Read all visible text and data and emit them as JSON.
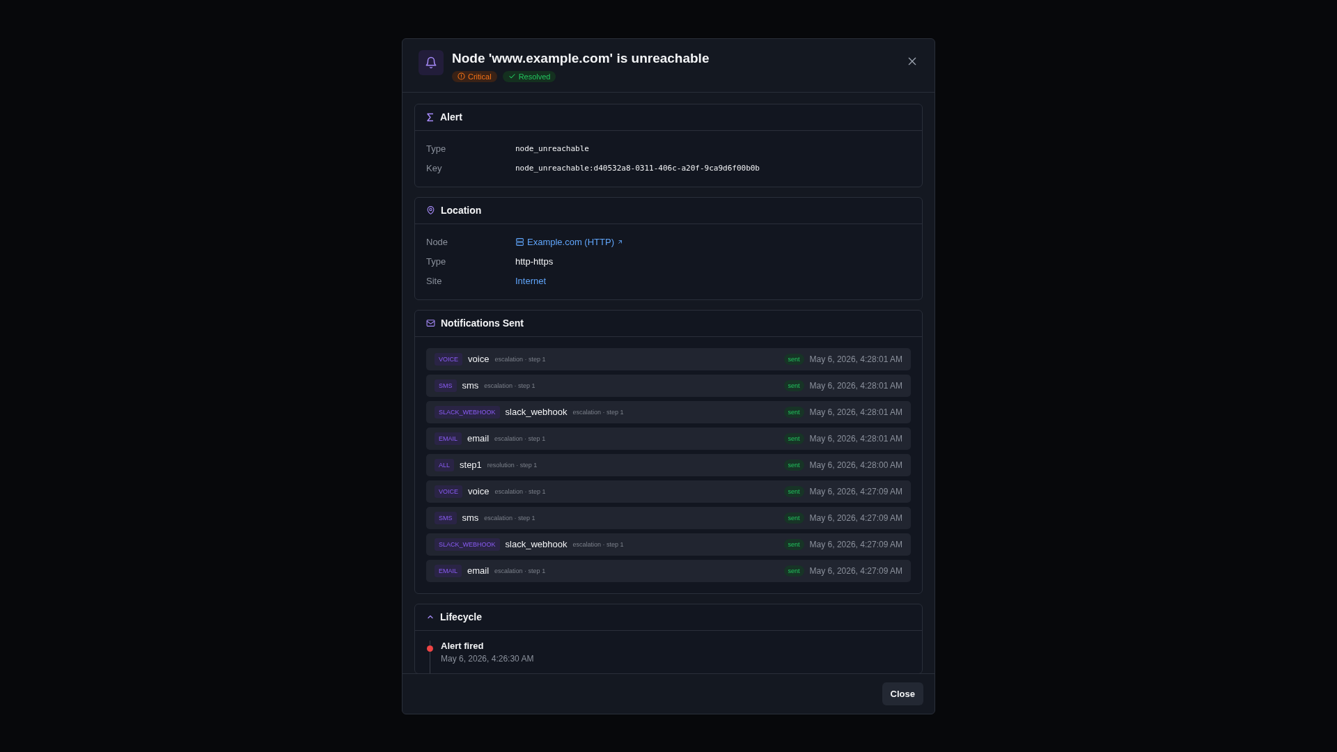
{
  "dialog": {
    "title": "Node 'www.example.com' is unreachable",
    "badges": [
      {
        "kind": "severity",
        "label": "Critical"
      },
      {
        "kind": "state",
        "label": "Resolved"
      }
    ],
    "close_button": "Close"
  },
  "alert": {
    "title": "Alert",
    "rows": [
      {
        "label": "Type",
        "value": "node_unreachable",
        "kind": "mono"
      },
      {
        "label": "Key",
        "value": "node_unreachable:d40532a8-0311-406c-a20f-9ca9d6f00b0b",
        "kind": "mono"
      }
    ]
  },
  "location": {
    "title": "Location",
    "rows": [
      {
        "label": "Node",
        "value": "Example.com (HTTP)",
        "kind": "node-link"
      },
      {
        "label": "Type",
        "value": "http-https",
        "kind": "text"
      },
      {
        "label": "Site",
        "value": "Internet",
        "kind": "link"
      }
    ]
  },
  "notifications": {
    "title": "Notifications Sent",
    "items": [
      {
        "channel": "VOICE",
        "target": "voice",
        "meta": "escalation · step 1",
        "status": "sent",
        "time": "May 6, 2026, 4:28:01 AM"
      },
      {
        "channel": "SMS",
        "target": "sms",
        "meta": "escalation · step 1",
        "status": "sent",
        "time": "May 6, 2026, 4:28:01 AM"
      },
      {
        "channel": "SLACK_WEBHOOK",
        "target": "slack_webhook",
        "meta": "escalation · step 1",
        "status": "sent",
        "time": "May 6, 2026, 4:28:01 AM"
      },
      {
        "channel": "EMAIL",
        "target": "email",
        "meta": "escalation · step 1",
        "status": "sent",
        "time": "May 6, 2026, 4:28:01 AM"
      },
      {
        "channel": "ALL",
        "target": "step1",
        "meta": "resolution · step 1",
        "status": "sent",
        "time": "May 6, 2026, 4:28:00 AM"
      },
      {
        "channel": "VOICE",
        "target": "voice",
        "meta": "escalation · step 1",
        "status": "sent",
        "time": "May 6, 2026, 4:27:09 AM"
      },
      {
        "channel": "SMS",
        "target": "sms",
        "meta": "escalation · step 1",
        "status": "sent",
        "time": "May 6, 2026, 4:27:09 AM"
      },
      {
        "channel": "SLACK_WEBHOOK",
        "target": "slack_webhook",
        "meta": "escalation · step 1",
        "status": "sent",
        "time": "May 6, 2026, 4:27:09 AM"
      },
      {
        "channel": "EMAIL",
        "target": "email",
        "meta": "escalation · step 1",
        "status": "sent",
        "time": "May 6, 2026, 4:27:09 AM"
      }
    ]
  },
  "lifecycle": {
    "title": "Lifecycle",
    "expanded": true,
    "events": [
      {
        "label": "Alert fired",
        "time": "May 6, 2026, 4:26:30 AM",
        "color": "#ef4444"
      }
    ]
  }
}
